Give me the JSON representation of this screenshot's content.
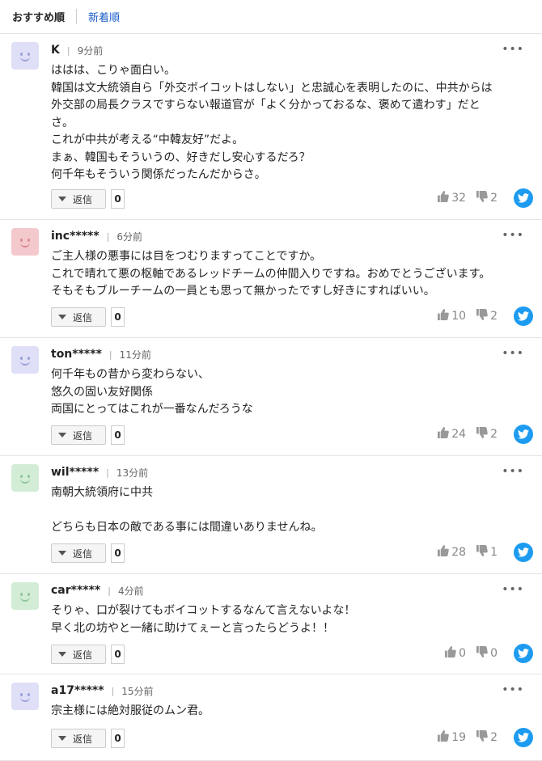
{
  "sort": {
    "recommended": "おすすめ順",
    "newest": "新着順"
  },
  "reply_label": "返信",
  "colors": {
    "blue_avatar": "#dfe0f7",
    "red_avatar": "#f4c9cd",
    "green_avatar": "#d3ecd6",
    "twitter": "#1d9bf0",
    "link": "#1a5cc8"
  },
  "comments": [
    {
      "name": "K",
      "time": "9分前",
      "avatar_color": "blue",
      "lines": [
        "ははは、こりゃ面白い。",
        "韓国は文大統領自ら「外交ボイコットはしない」と忠誠心を表明したのに、中共からは",
        "外交部の局長クラスですらない報道官が「よく分かっておるな、褒めて遣わす」だと",
        "さ。",
        "これが中共が考える“中韓友好”だよ。",
        "まぁ、韓国もそういうの、好きだし安心するだろ？",
        "何千年もそういう関係だったんだからさ。"
      ],
      "reply_count": "0",
      "likes": "32",
      "dislikes": "2"
    },
    {
      "name": "inc*****",
      "time": "6分前",
      "avatar_color": "red",
      "lines": [
        "ご主人様の悪事には目をつむりますってことですか。",
        "これで晴れて悪の枢軸であるレッドチームの仲間入りですね。おめでとうございます。",
        "そもそもブルーチームの一員とも思って無かったですし好きにすればいい。"
      ],
      "reply_count": "0",
      "likes": "10",
      "dislikes": "2"
    },
    {
      "name": "ton*****",
      "time": "11分前",
      "avatar_color": "blue",
      "lines": [
        "何千年もの昔から変わらない、",
        "悠久の固い友好関係",
        "両国にとってはこれが一番なんだろうな"
      ],
      "reply_count": "0",
      "likes": "24",
      "dislikes": "2"
    },
    {
      "name": "wil*****",
      "time": "13分前",
      "avatar_color": "green",
      "lines": [
        "南朝大統領府に中共",
        "",
        "どちらも日本の敵である事には間違いありませんね。"
      ],
      "reply_count": "0",
      "likes": "28",
      "dislikes": "1"
    },
    {
      "name": "car*****",
      "time": "4分前",
      "avatar_color": "green",
      "lines": [
        "そりゃ、口が裂けてもボイコットするなんて言えないよな！",
        "早く北の坊やと一緒に助けてぇーと言ったらどうよ！！"
      ],
      "reply_count": "0",
      "likes": "0",
      "dislikes": "0"
    },
    {
      "name": "a17*****",
      "time": "15分前",
      "avatar_color": "blue",
      "lines": [
        "宗主様には絶対服従のムン君。"
      ],
      "reply_count": "0",
      "likes": "19",
      "dislikes": "2"
    }
  ]
}
